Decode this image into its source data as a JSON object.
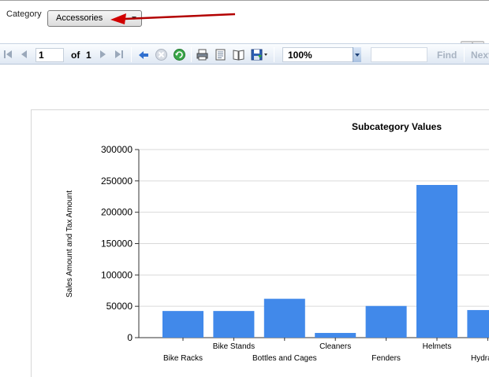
{
  "parameters": {
    "category_label": "Category",
    "category_value": "Accessories"
  },
  "toolbar": {
    "current_page": "1",
    "of_label": "of",
    "total_pages": "1",
    "zoom": "100%",
    "find_label": "Find",
    "next_label": "Next"
  },
  "chart_data": {
    "type": "bar",
    "title": "Subcategory Values",
    "ylabel": "Sales Amount and Tax Amount",
    "xlabel": "",
    "ylim": [
      0,
      300000
    ],
    "yticks": [
      0,
      50000,
      100000,
      150000,
      200000,
      250000,
      300000
    ],
    "categories": [
      "Bike Racks",
      "Bike Stands",
      "Bottles and Cages",
      "Cleaners",
      "Fenders",
      "Helmets",
      "Hydration"
    ],
    "values": [
      42500,
      42500,
      62000,
      7500,
      50500,
      243500,
      44000
    ],
    "color": "#4189ea"
  }
}
